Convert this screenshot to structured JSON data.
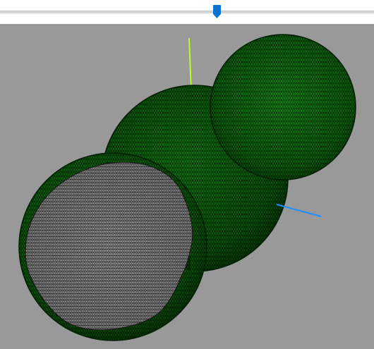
{
  "viewer": {
    "background_color": "#999999",
    "slider": {
      "value_fraction": 0.58,
      "thumb_color": "#0a74d0",
      "track_color": "#d6d6d6"
    },
    "scene": {
      "axes": [
        {
          "name": "y-axis",
          "color": "#b7ff1e"
        },
        {
          "name": "x-axis",
          "color": "#1e90ff"
        }
      ],
      "spheres": [
        {
          "name": "middle-sphere",
          "fill": "#0b5c0b",
          "wireframe": "#000000"
        },
        {
          "name": "upper-right-sphere",
          "fill": "#0e6a0e",
          "wireframe": "#000000"
        },
        {
          "name": "lower-left-sphere-cutaway",
          "fill": "#0b5c0b",
          "inner_fill": "#9f9f9f",
          "wireframe": "#000000"
        }
      ]
    }
  }
}
